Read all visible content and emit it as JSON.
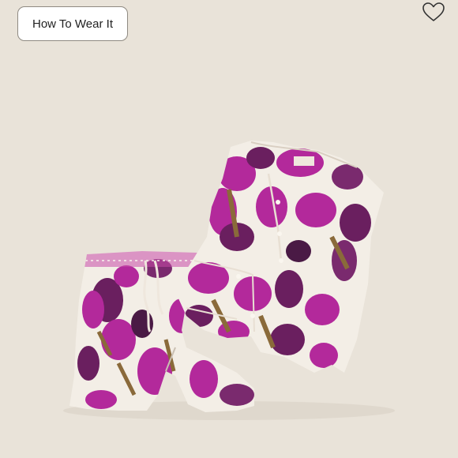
{
  "header": {
    "how_to_wear_label": "How To Wear It"
  },
  "icons": {
    "favorite": "heart-outline-icon"
  },
  "product_image": {
    "description_icon": "pajama-set-image",
    "colors": {
      "background": "#e9e3d9",
      "fabric_base": "#f3eee6",
      "print_magenta": "#b3299b",
      "print_purple": "#6a1f5f",
      "print_brown": "#8a6a3a"
    }
  }
}
